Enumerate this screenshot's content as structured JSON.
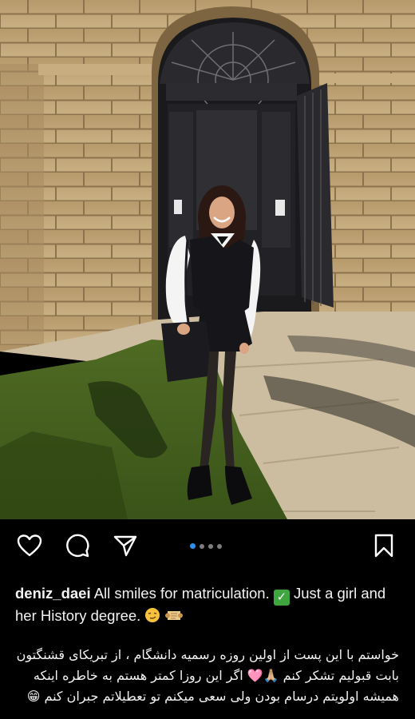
{
  "post": {
    "username": "deniz_daei",
    "caption_part1": "All smiles for matriculation.",
    "caption_check_icon": "check-mark-icon",
    "caption_part2": "Just a girl and her History degree.",
    "caption_emojis": [
      "smirk-emoji",
      "scroll-emoji"
    ],
    "persian_lines": [
      "خواستم با این پست از اولین روزه رسمیه دانشگام ، از تبریکای قشنگتون",
      "بابت قبولیم تشکر کنم 🙏🏼🩷 اگر این روزا کمتر هستم به خاطره اینکه",
      "همیشه اولویتم درسام بودن ولی سعی میکنم تو تعطیلاتم جبران کنم 😁"
    ]
  },
  "actions": {
    "icons": [
      "heart-icon",
      "comment-icon",
      "share-icon",
      "bookmark-icon"
    ],
    "carousel": {
      "count": 4,
      "active_index": 0
    }
  },
  "colors": {
    "background": "#000000",
    "accent_dot": "#2f8fe8",
    "check_badge": "#3fa63f"
  }
}
